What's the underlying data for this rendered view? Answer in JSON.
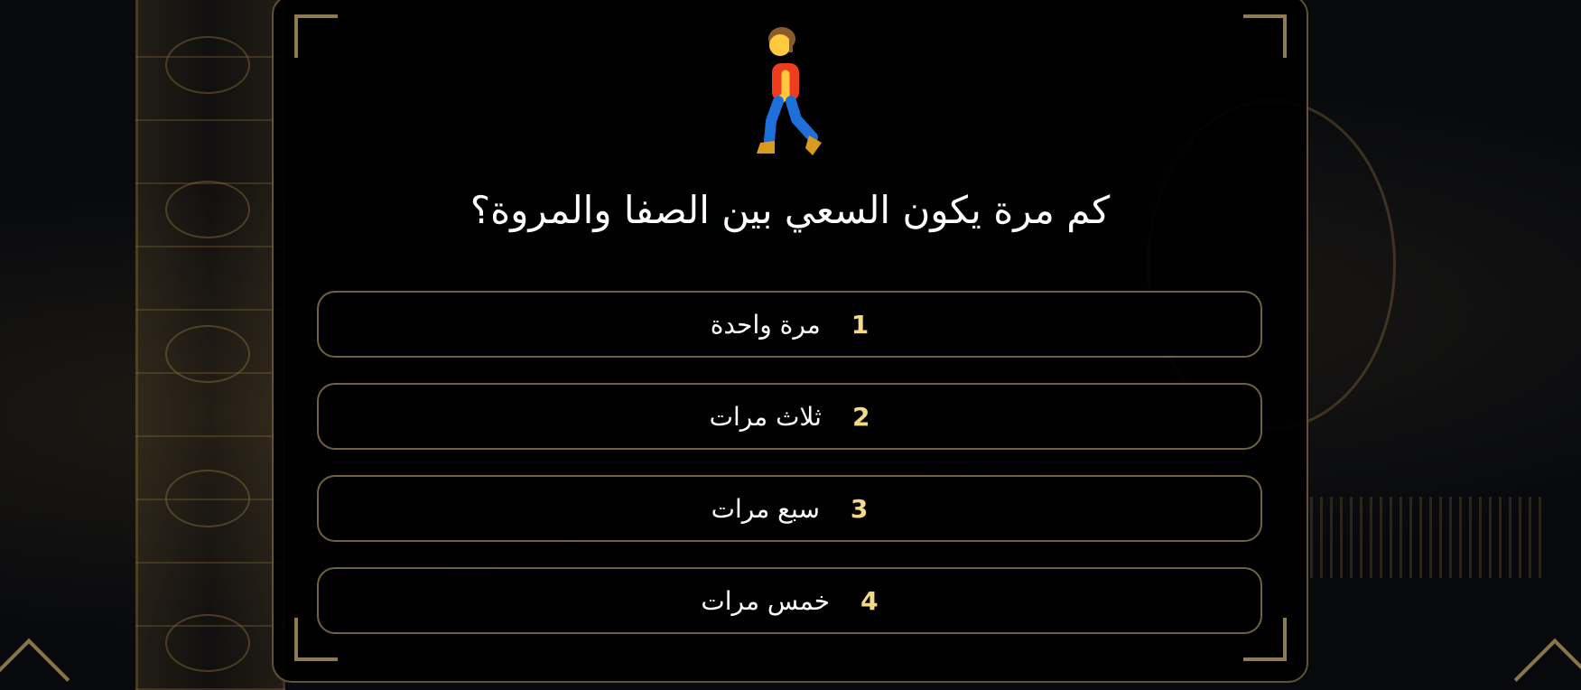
{
  "quiz": {
    "icon": "person-walking-icon",
    "question": "كم مرة يكون السعي بين الصفا والمروة؟",
    "answers": [
      {
        "number": "1",
        "text": "مرة واحدة"
      },
      {
        "number": "2",
        "text": "ثلاث مرات"
      },
      {
        "number": "3",
        "text": "سبع مرات"
      },
      {
        "number": "4",
        "text": "خمس مرات"
      }
    ]
  },
  "colors": {
    "accent_gold": "#f3d98a",
    "frame_gold": "#8f7b52",
    "answer_border": "#6e6243",
    "card_background": "#000000"
  }
}
